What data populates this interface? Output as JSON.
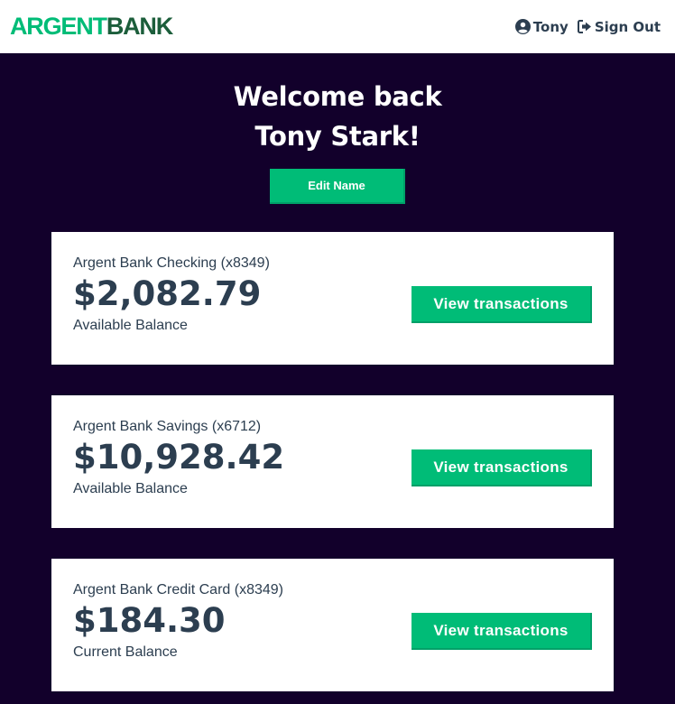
{
  "brand": {
    "logo_part1": "ARGENT",
    "logo_part2": "BANK",
    "color_primary": "#00bc77",
    "color_dark": "#1c5e3b",
    "background": "#12002b"
  },
  "nav": {
    "user_icon": "user-circle-icon",
    "user_label": "Tony",
    "signout_icon": "sign-out-icon",
    "signout_label": "Sign Out"
  },
  "header": {
    "line1": "Welcome back",
    "line2": "Tony Stark!",
    "edit_button": "Edit Name"
  },
  "accounts": [
    {
      "title": "Argent Bank Checking (x8349)",
      "amount": "$2,082.79",
      "description": "Available Balance",
      "button": "View transactions"
    },
    {
      "title": "Argent Bank Savings (x6712)",
      "amount": "$10,928.42",
      "description": "Available Balance",
      "button": "View transactions"
    },
    {
      "title": "Argent Bank Credit Card (x8349)",
      "amount": "$184.30",
      "description": "Current Balance",
      "button": "View transactions"
    }
  ]
}
